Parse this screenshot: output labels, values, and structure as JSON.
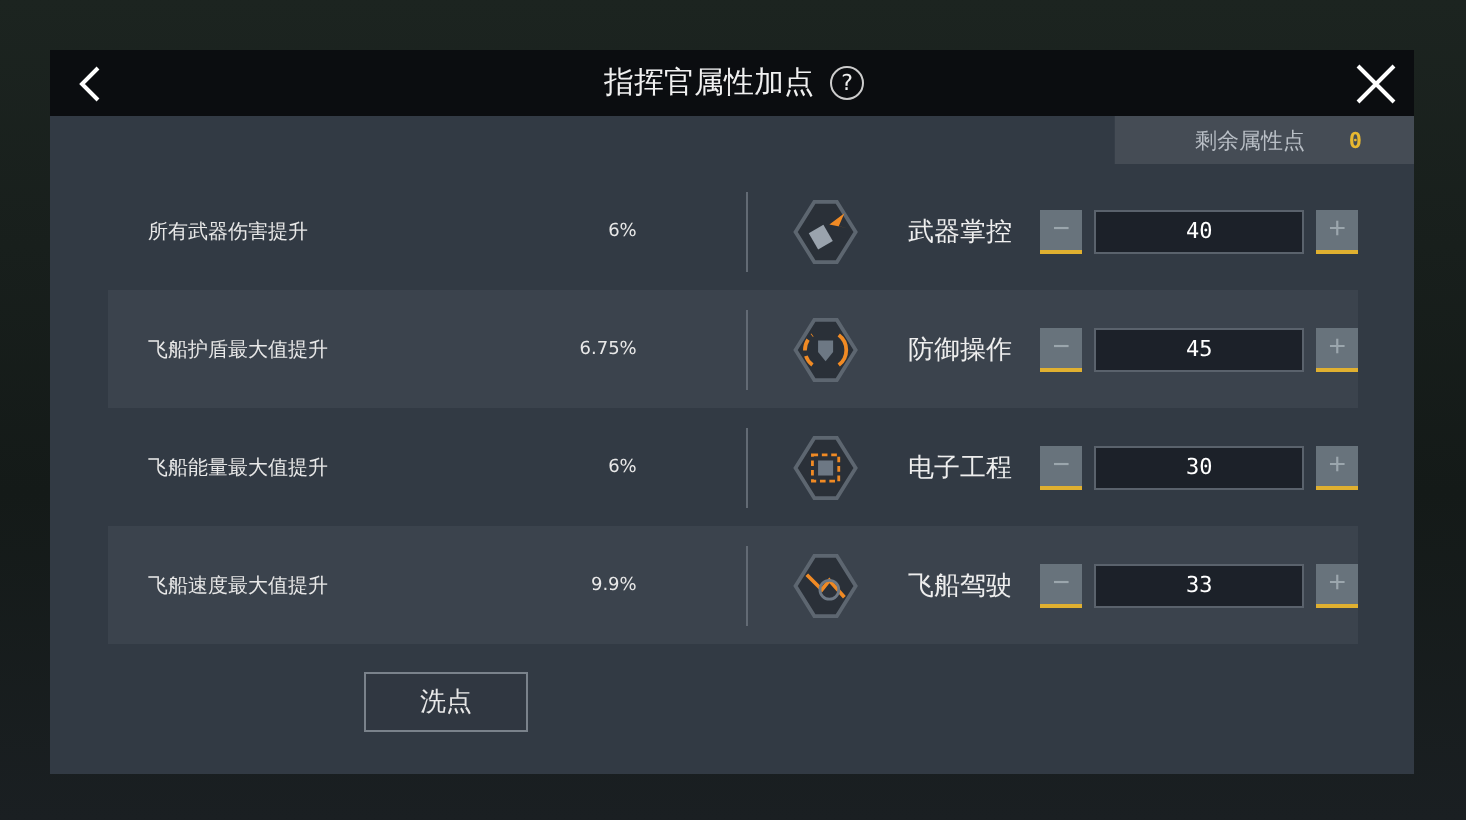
{
  "window": {
    "title": "指挥官属性加点",
    "help": "?"
  },
  "remaining": {
    "label": "剩余属性点",
    "value": "0"
  },
  "rows": [
    {
      "effect": "所有武器伤害提升",
      "amount": "6%",
      "kind": "weapon",
      "name": "武器掌控",
      "minus": "−",
      "value": "40",
      "plus": "+"
    },
    {
      "effect": "飞船护盾最大值提升",
      "amount": "6.75%",
      "kind": "shield",
      "name": "防御操作",
      "minus": "−",
      "value": "45",
      "plus": "+"
    },
    {
      "effect": "飞船能量最大值提升",
      "amount": "6%",
      "kind": "chip",
      "name": "电子工程",
      "minus": "−",
      "value": "30",
      "plus": "+"
    },
    {
      "effect": "飞船速度最大值提升",
      "amount": "9.9%",
      "kind": "speed",
      "name": "飞船驾驶",
      "minus": "−",
      "value": "33",
      "plus": "+"
    }
  ],
  "reset_button": "洗点"
}
